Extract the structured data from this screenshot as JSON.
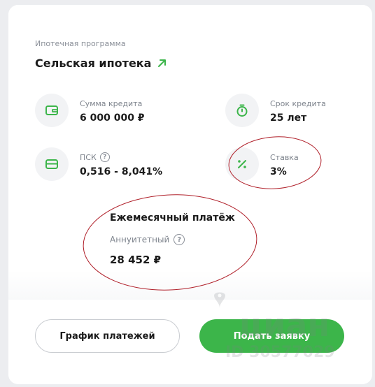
{
  "program": {
    "label": "Ипотечная программа",
    "title": "Сельская ипотека",
    "title_icon": "arrow-up-right-icon"
  },
  "items": {
    "loan_amount": {
      "label": "Сумма кредита",
      "value": "6 000 000 ₽",
      "icon": "wallet-icon"
    },
    "loan_term": {
      "label": "Срок кредита",
      "value": "25 лет",
      "icon": "stopwatch-icon"
    },
    "psk": {
      "label": "ПСК",
      "value": "0,516 - 8,041%",
      "icon": "card-icon",
      "help_icon": "question-icon"
    },
    "rate": {
      "label": "Ставка",
      "value": "3%",
      "icon": "percent-icon"
    }
  },
  "monthly": {
    "title": "Ежемесячный платёж",
    "type": "Аннуитетный",
    "value": "28 452 ₽",
    "help_icon": "question-icon"
  },
  "buttons": {
    "schedule": "График платежей",
    "apply": "Подать заявку"
  },
  "watermark": {
    "brand": "циан",
    "id": "ID 30577029"
  },
  "colors": {
    "accent": "#3cb54a",
    "annotation": "#b0202a"
  }
}
